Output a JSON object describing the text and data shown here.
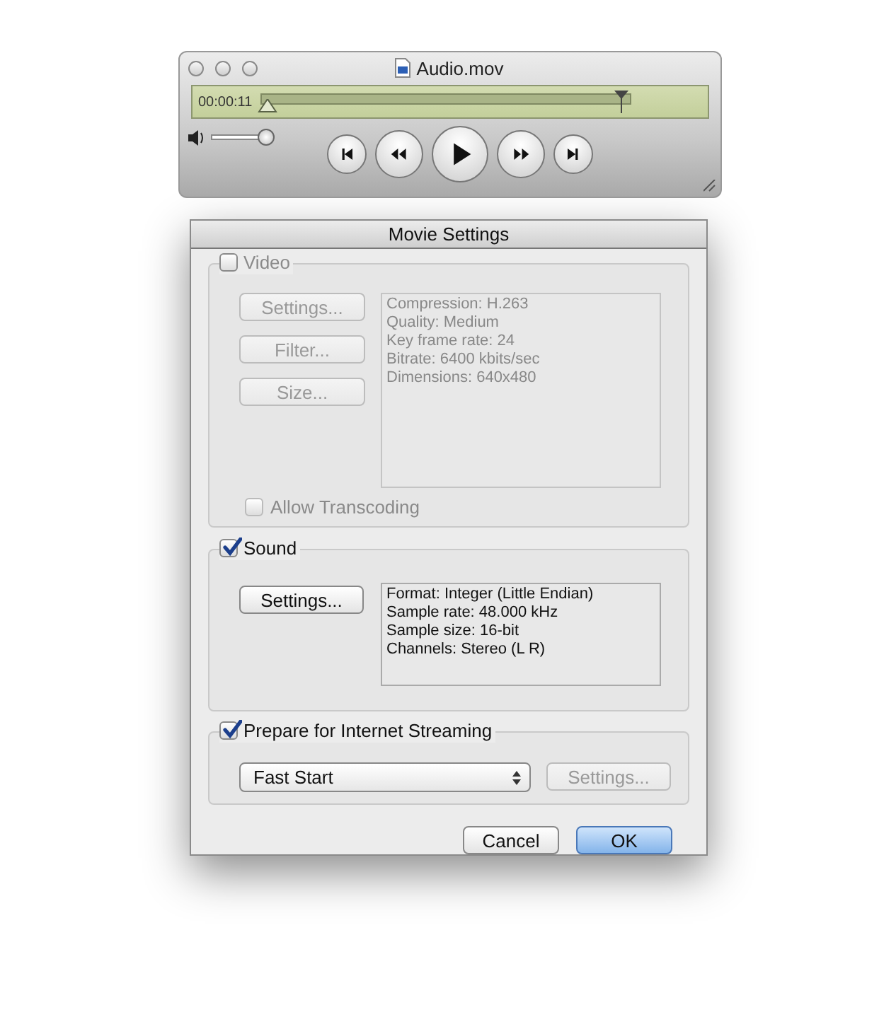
{
  "player": {
    "title": "Audio.mov",
    "time": "00:00:11",
    "position": {
      "level": 0.01
    },
    "volume": {
      "level": 0.93
    },
    "transport": [
      {
        "kind": "skip-back"
      },
      {
        "kind": "rewind"
      },
      {
        "kind": "play"
      },
      {
        "kind": "fast-forward"
      },
      {
        "kind": "skip-forward"
      }
    ]
  },
  "dialog": {
    "title": "Movie Settings",
    "video": {
      "label": "Video",
      "checked": false,
      "buttons": [
        {
          "label": "Settings...",
          "disabled": true
        },
        {
          "label": "Filter...",
          "disabled": true
        },
        {
          "label": "Size...",
          "disabled": true
        }
      ],
      "info": [
        "Compression: H.263",
        "Quality: Medium",
        "Key frame rate: 24",
        "Bitrate: 6400 kbits/sec",
        "Dimensions: 640x480"
      ],
      "transcoding": {
        "label": "Allow Transcoding",
        "checked": false,
        "disabled": true
      }
    },
    "sound": {
      "label": "Sound",
      "checked": true,
      "buttons": [
        {
          "label": "Settings...",
          "disabled": false
        }
      ],
      "info": [
        "Format: Integer (Little Endian)",
        "Sample rate: 48.000 kHz",
        "Sample size: 16-bit",
        "Channels: Stereo (L R)"
      ]
    },
    "streaming": {
      "label": "Prepare for Internet Streaming",
      "checked": true,
      "popup": "Fast Start",
      "button": {
        "label": "Settings...",
        "disabled": true
      }
    },
    "buttons": [
      {
        "label": "Cancel",
        "default": false
      },
      {
        "label": "OK",
        "default": true
      }
    ]
  }
}
